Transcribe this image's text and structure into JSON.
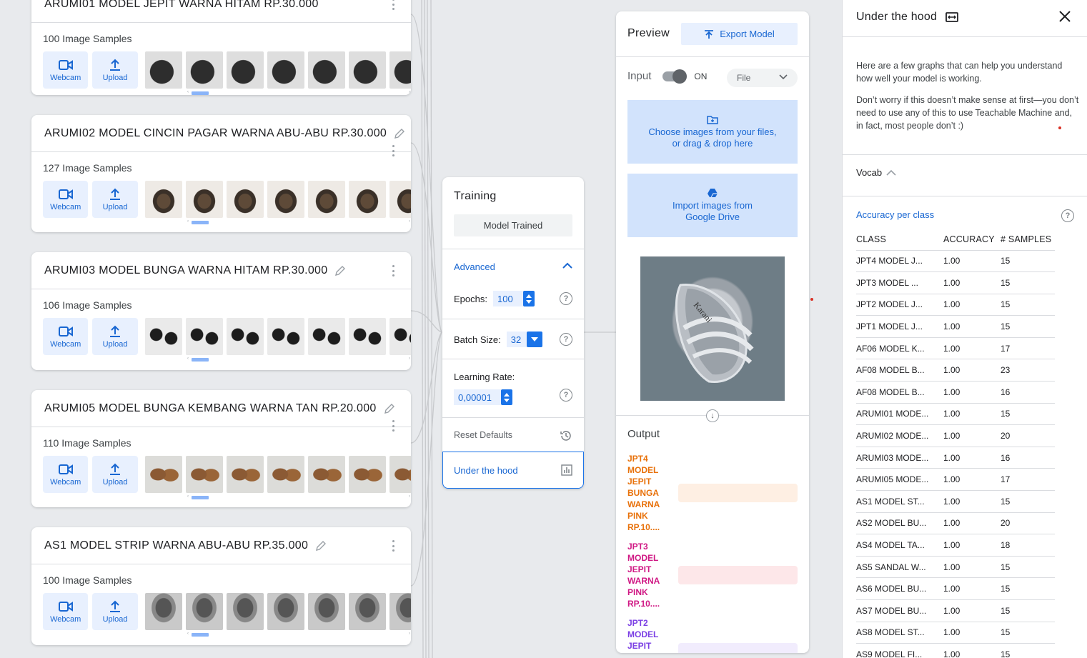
{
  "classes": [
    {
      "title": "ARUMI01 MODEL JEPIT WARNA HITAM RP.30.000",
      "samples": "100 Image Samples"
    },
    {
      "title": "ARUMI02 MODEL CINCIN PAGAR WARNA ABU-ABU RP.30.000",
      "samples": "127 Image Samples"
    },
    {
      "title": "ARUMI03 MODEL BUNGA WARNA HITAM RP.30.000",
      "samples": "106 Image Samples"
    },
    {
      "title": "ARUMI05 MODEL BUNGA KEMBANG WARNA TAN RP.20.000",
      "samples": "110 Image Samples"
    },
    {
      "title": "AS1 MODEL STRIP WARNA ABU-ABU RP.35.000",
      "samples": "100 Image Samples"
    }
  ],
  "sample_sources": {
    "webcam": "Webcam",
    "upload": "Upload"
  },
  "training": {
    "title": "Training",
    "status": "Model Trained",
    "advanced": "Advanced",
    "epochs_label": "Epochs:",
    "epochs_value": "100",
    "batch_label": "Batch Size:",
    "batch_value": "32",
    "lr_label": "Learning Rate:",
    "lr_value": "0,00001",
    "reset": "Reset Defaults",
    "under_hood": "Under the hood"
  },
  "preview": {
    "title": "Preview",
    "export": "Export Model",
    "input_label": "Input",
    "toggle_state": "ON",
    "source": "File",
    "choose_line1": "Choose images from your files,",
    "choose_line2": "or drag & drop here",
    "drive_line1": "Import images from",
    "drive_line2": "Google Drive",
    "image_brand": "Karani",
    "output_title": "Output",
    "outputs": [
      {
        "label": "JPT4 MODEL JEPIT BUNGA WARNA PINK RP.10....",
        "color": "#e8710a",
        "bar": "#feefe3"
      },
      {
        "label": "JPT3 MODEL JEPIT WARNA PINK RP.10....",
        "color": "#d01884",
        "bar": "#fde7e9"
      },
      {
        "label": "JPT2 MODEL JEPIT",
        "color": "#7b3fe4",
        "bar": "#f1ecfd"
      }
    ]
  },
  "hood": {
    "title": "Under the hood",
    "intro": "Here are a few graphs that can help you understand how well your model is working.",
    "note": "Don’t worry if this doesn’t make sense at first—you don’t need to use any of this to use Teachable Machine and, in fact, most people don’t :)",
    "vocab": "Vocab",
    "accuracy_title": "Accuracy per class",
    "columns": [
      "CLASS",
      "ACCURACY",
      "# SAMPLES"
    ],
    "rows": [
      [
        "JPT4 MODEL J...",
        "1.00",
        "15"
      ],
      [
        "JPT3 MODEL ...",
        "1.00",
        "15"
      ],
      [
        "JPT2 MODEL J...",
        "1.00",
        "15"
      ],
      [
        "JPT1 MODEL J...",
        "1.00",
        "15"
      ],
      [
        "AF06 MODEL K...",
        "1.00",
        "17"
      ],
      [
        "AF08 MODEL B...",
        "1.00",
        "23"
      ],
      [
        "AF08 MODEL B...",
        "1.00",
        "16"
      ],
      [
        "ARUMI01 MODE...",
        "1.00",
        "15"
      ],
      [
        "ARUMI02 MODE...",
        "1.00",
        "20"
      ],
      [
        "ARUMI03 MODE...",
        "1.00",
        "16"
      ],
      [
        "ARUMI05 MODE...",
        "1.00",
        "17"
      ],
      [
        "AS1 MODEL ST...",
        "1.00",
        "15"
      ],
      [
        "AS2 MODEL BU...",
        "1.00",
        "20"
      ],
      [
        "AS4 MODEL TA...",
        "1.00",
        "18"
      ],
      [
        "AS5 SANDAL W...",
        "1.00",
        "15"
      ],
      [
        "AS6 MODEL BU...",
        "1.00",
        "15"
      ],
      [
        "AS7 MODEL BU...",
        "1.00",
        "15"
      ],
      [
        "AS8 MODEL ST...",
        "1.00",
        "15"
      ],
      [
        "AS9 MODEL FI...",
        "1.00",
        "15"
      ]
    ]
  }
}
